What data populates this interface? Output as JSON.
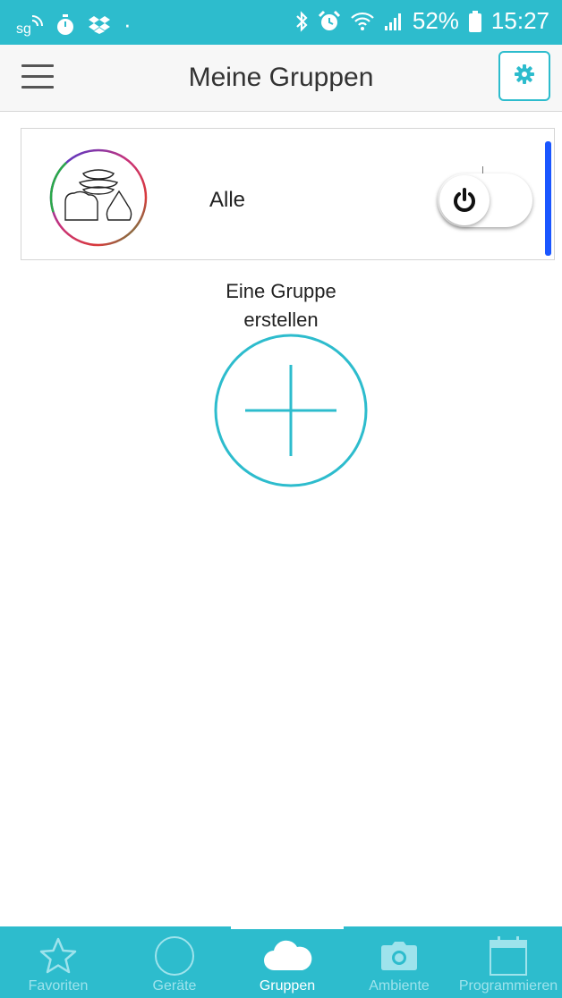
{
  "status_bar": {
    "carrier_icon": "sg-wifi-calling-icon",
    "left_icons": [
      "timer-icon",
      "dropbox-icon"
    ],
    "dot": "·",
    "right_icons": [
      "bluetooth-icon",
      "alarm-icon",
      "wifi-icon",
      "signal-icon"
    ],
    "battery_percent": "52%",
    "time": "15:27"
  },
  "header": {
    "title": "Meine Gruppen",
    "menu_icon": "hamburger-menu-icon",
    "settings_icon": "gear-icon"
  },
  "groups": [
    {
      "name": "Alle",
      "icon": "lamp-group-icon",
      "power": "off"
    }
  ],
  "create_group": {
    "label_line1": "Eine Gruppe",
    "label_line2": "erstellen",
    "icon": "plus-circle-icon"
  },
  "bottom_nav": {
    "items": [
      {
        "label": "Favoriten",
        "icon": "star-icon",
        "active": false
      },
      {
        "label": "Geräte",
        "icon": "circle-icon",
        "active": false
      },
      {
        "label": "Gruppen",
        "icon": "cloud-icon",
        "active": true
      },
      {
        "label": "Ambiente",
        "icon": "camera-icon",
        "active": false
      },
      {
        "label": "Programmieren",
        "icon": "calendar-icon",
        "active": false
      }
    ]
  },
  "colors": {
    "accent": "#2dbccd",
    "highlight": "#1a56ff",
    "text": "#222222"
  }
}
